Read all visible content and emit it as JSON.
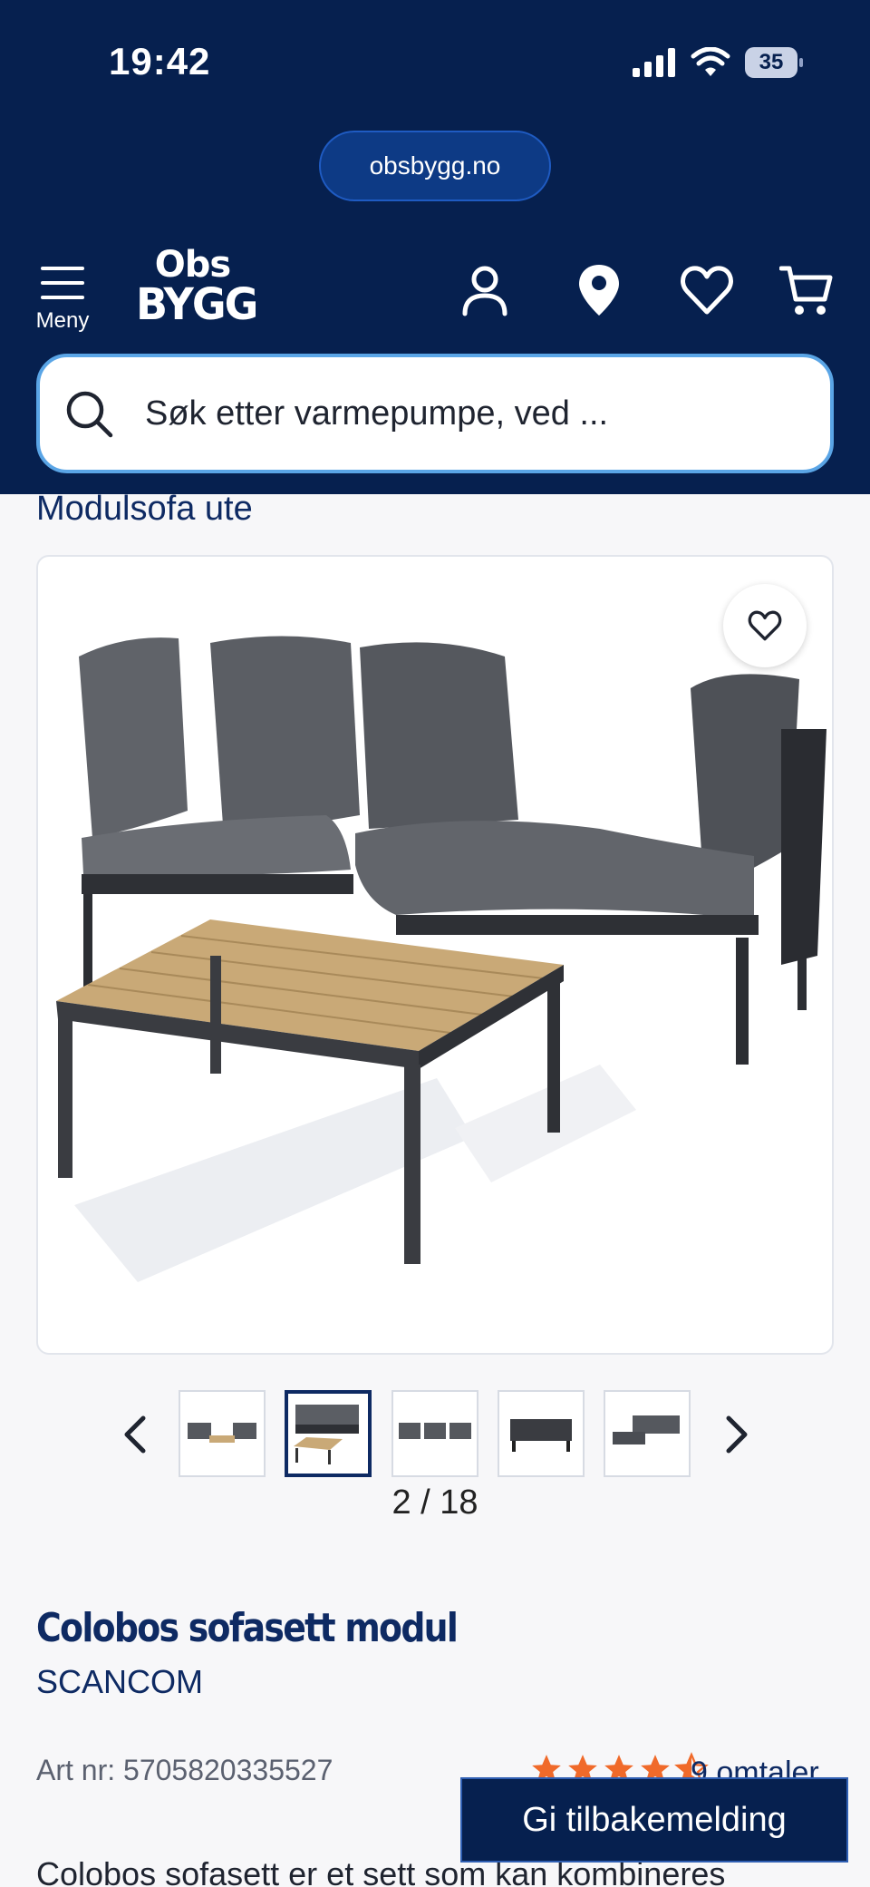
{
  "status_bar": {
    "time": "19:42",
    "battery": "35"
  },
  "browser": {
    "url": "obsbygg.no"
  },
  "header": {
    "menu_label": "Meny",
    "logo_line1": "Obs",
    "logo_line2": "BYGG"
  },
  "search": {
    "placeholder": "Søk etter varmepumpe, ved ..."
  },
  "breadcrumb": {
    "current": "Modulsofa ute"
  },
  "gallery": {
    "counter": "2 / 18",
    "active_index": 2,
    "total": 18
  },
  "product": {
    "title": "Colobos sofasett modul",
    "brand": "SCANCOM",
    "art_nr": "Art nr: 5705820335527",
    "rating": 4.5,
    "reviews": "9 omtaler",
    "description": "Colobos sofasett er et sett som kan kombineres"
  },
  "feedback_button": "Gi tilbakemelding",
  "colors": {
    "header_bg": "#06204f",
    "accent": "#0e2a63",
    "star": "#f06a2a",
    "search_border": "#5aa5e6"
  }
}
